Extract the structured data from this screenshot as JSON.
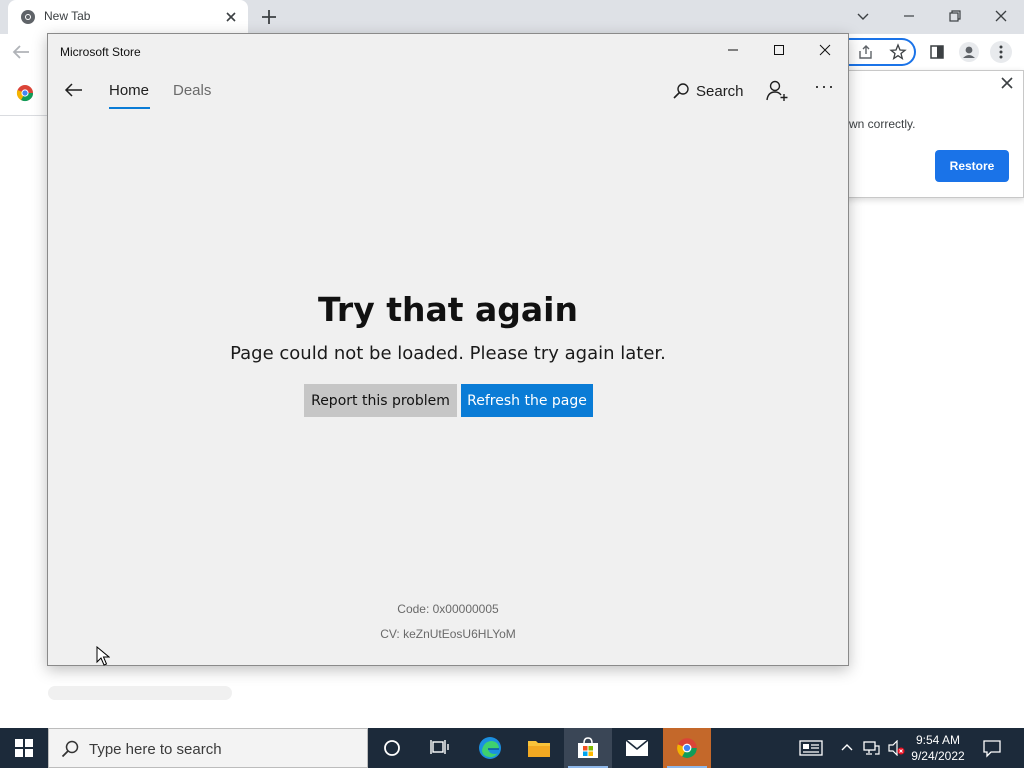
{
  "chrome": {
    "tab_title": "New Tab",
    "restore_text": "wn correctly.",
    "restore_button": "Restore"
  },
  "store": {
    "window_title": "Microsoft Store",
    "nav": {
      "home": "Home",
      "deals": "Deals",
      "search": "Search"
    },
    "error": {
      "title": "Try that again",
      "message": "Page could not be loaded. Please try again later.",
      "report_button": "Report this problem",
      "refresh_button": "Refresh the page",
      "code": "Code: 0x00000005",
      "cv": "CV: keZnUtEosU6HLYoM"
    }
  },
  "taskbar": {
    "search_placeholder": "Type here to search",
    "time": "9:54 AM",
    "date": "9/24/2022"
  },
  "colors": {
    "accent": "#0a7cd6",
    "chrome_blue": "#1a73e8",
    "taskbar": "#1c2a3a"
  }
}
